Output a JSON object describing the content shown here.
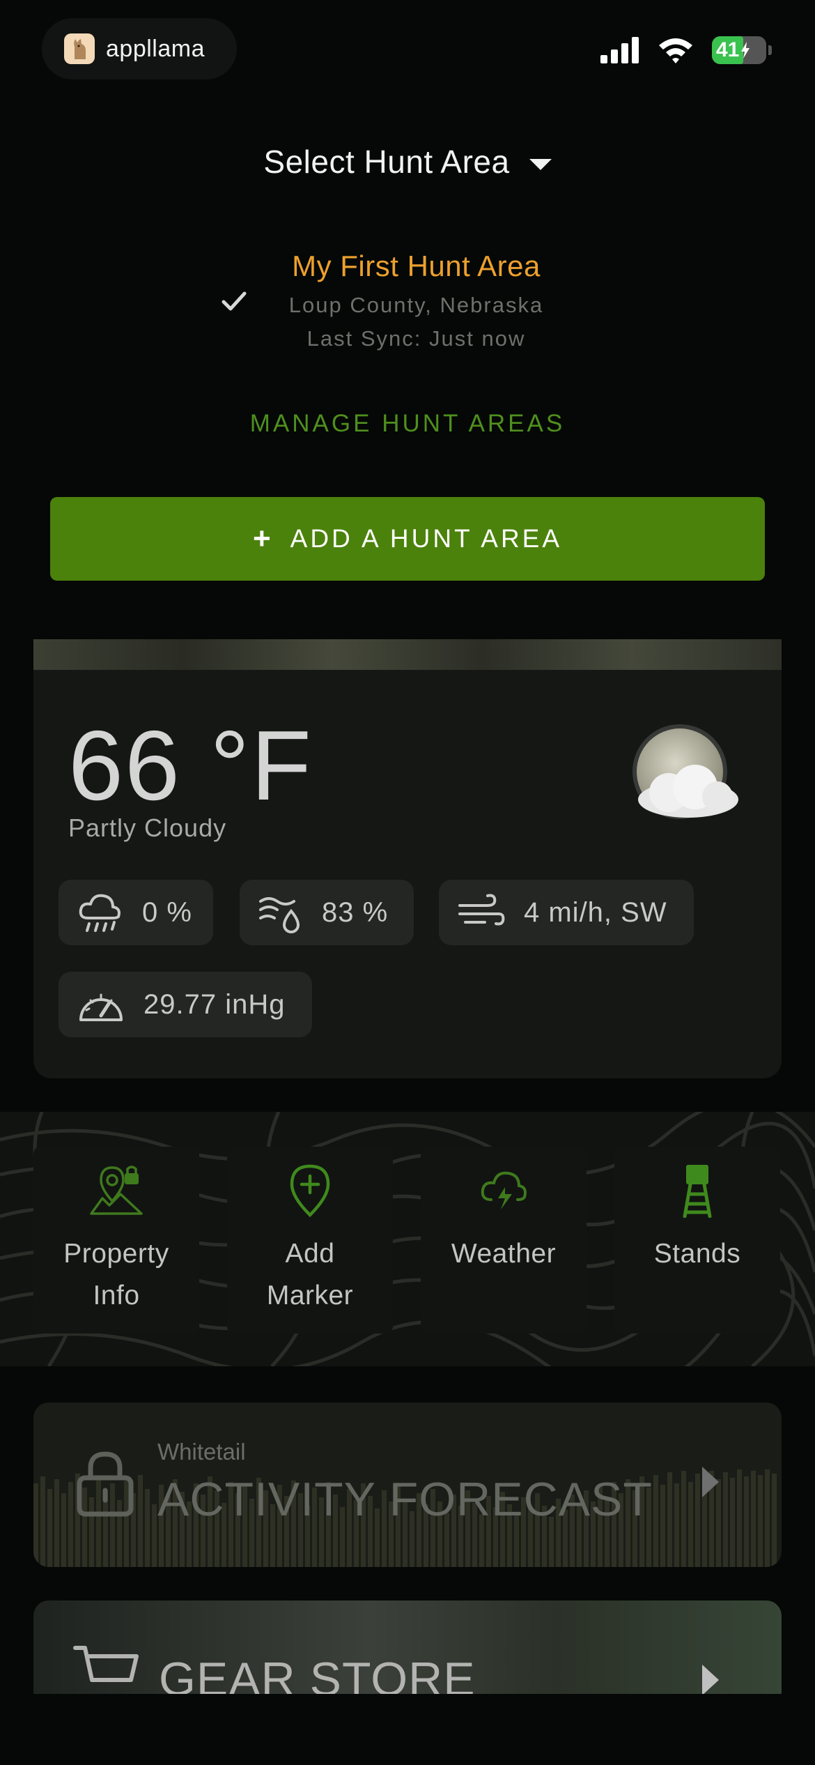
{
  "status_bar": {
    "brand": "appllama",
    "battery": "41"
  },
  "selector": {
    "title": "Select Hunt Area",
    "area_name": "My First Hunt Area",
    "area_location": "Loup County, Nebraska",
    "area_sync": "Last Sync: Just now",
    "manage_label": "MANAGE HUNT AREAS",
    "add_label": "ADD A HUNT AREA",
    "add_symbol": "+"
  },
  "weather": {
    "temperature": "66 °F",
    "condition": "Partly Cloudy",
    "icon": "partly-cloudy-night-icon",
    "precipitation": "0 %",
    "humidity": "83 %",
    "wind": "4 mi/h, SW",
    "pressure": "29.77 inHg"
  },
  "quick_actions": [
    {
      "line1": "Property",
      "line2": "Info",
      "icon": "property-lock-icon"
    },
    {
      "line1": "Add",
      "line2": "Marker",
      "icon": "add-marker-icon"
    },
    {
      "line1": "Weather",
      "line2": "",
      "icon": "storm-cloud-icon"
    },
    {
      "line1": "Stands",
      "line2": "",
      "icon": "tree-stand-icon"
    }
  ],
  "activity": {
    "subtitle": "Whitetail",
    "title": "ACTIVITY FORECAST"
  },
  "gear": {
    "title": "GEAR STORE"
  },
  "colors": {
    "accent_green": "#4b820c",
    "manage_green": "#4f8f1e",
    "area_orange": "#eda02e"
  }
}
